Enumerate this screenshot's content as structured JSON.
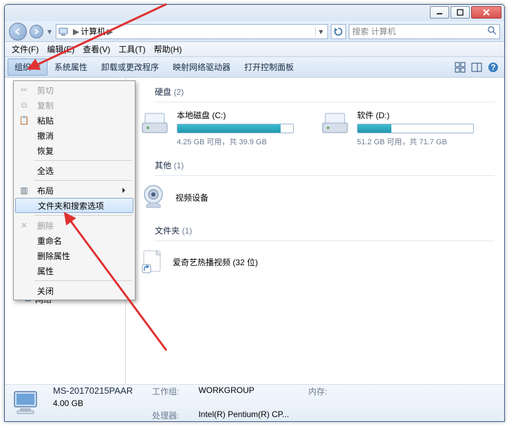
{
  "address": {
    "root": "计算机",
    "arrow": "▶"
  },
  "search": {
    "placeholder": "搜索 计算机"
  },
  "menubar": {
    "file": "文件(F)",
    "edit": "编辑(E)",
    "view": "查看(V)",
    "tools": "工具(T)",
    "help": "帮助(H)"
  },
  "toolbar": {
    "organize": "组织",
    "sys_props": "系统属性",
    "uninstall": "卸载或更改程序",
    "map_drive": "映射网络驱动器",
    "control_panel": "打开控制面板"
  },
  "sections": {
    "drives": {
      "label": "硬盘",
      "count": "(2)"
    },
    "other": {
      "label": "其他",
      "count": "(1)"
    },
    "folders": {
      "label": "文件夹",
      "count": "(1)"
    }
  },
  "drives": {
    "c": {
      "name": "本地磁盘 (C:)",
      "stats": "4.25 GB 可用，共 39.9 GB",
      "fill_pct": 89
    },
    "d": {
      "name": "软件 (D:)",
      "stats": "51.2 GB 可用，共 71.7 GB",
      "fill_pct": 29
    }
  },
  "devices": {
    "video": "视频设备"
  },
  "folders": {
    "f1": "爱奇艺热播视频 (32 位)"
  },
  "sidebar": {
    "network": "网络"
  },
  "status": {
    "name": "MS-20170215PAAR",
    "workgroup_lbl": "工作组:",
    "workgroup": "WORKGROUP",
    "mem_lbl": "内存:",
    "mem": "4.00 GB",
    "cpu_lbl": "处理器:",
    "cpu": "Intel(R) Pentium(R) CP..."
  },
  "ctx": {
    "cut": "剪切",
    "copy": "复制",
    "paste": "粘贴",
    "undo": "撤消",
    "redo": "恢复",
    "select_all": "全选",
    "layout": "布局",
    "folder_opts": "文件夹和搜索选项",
    "delete": "删除",
    "rename": "重命名",
    "remove_props": "删除属性",
    "properties": "属性",
    "close": "关闭"
  }
}
